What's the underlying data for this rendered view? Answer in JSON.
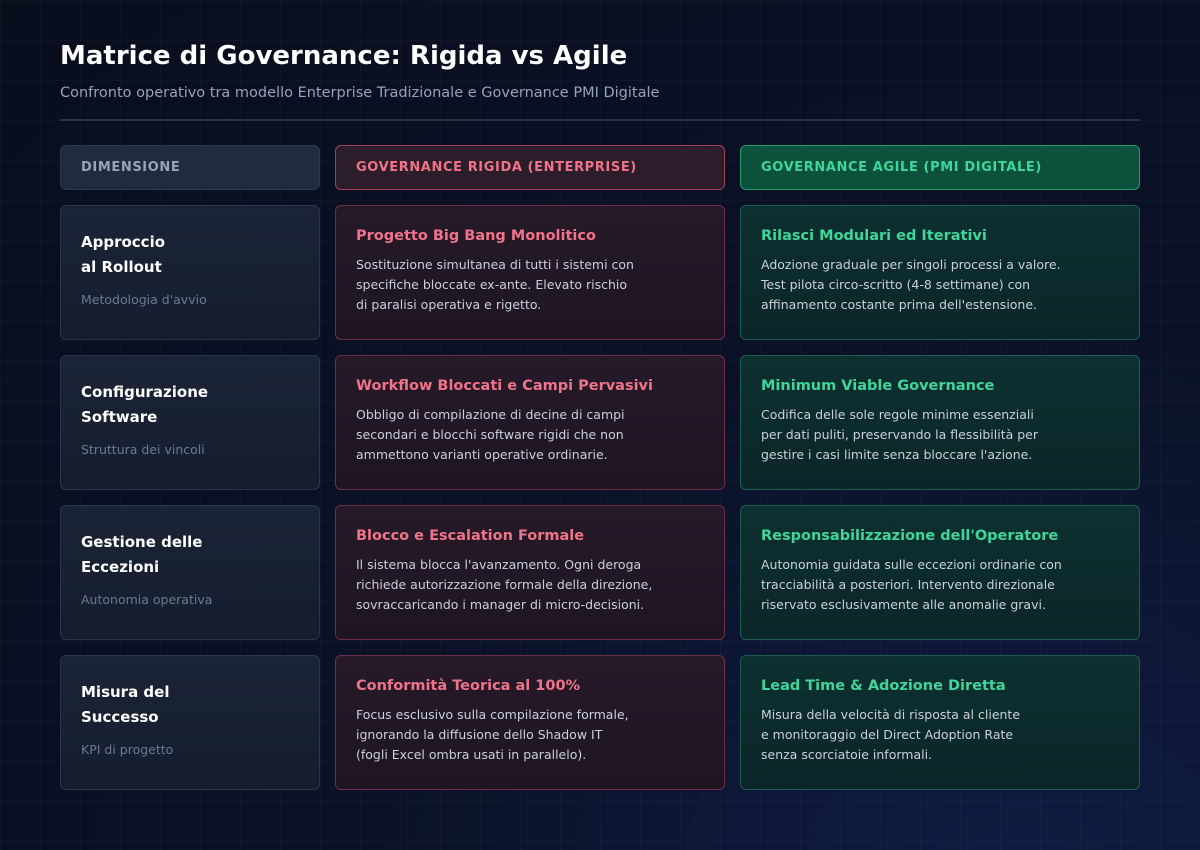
{
  "header": {
    "title": "Matrice di Governance: Rigida vs Agile",
    "subtitle": "Confronto operativo tra modello Enterprise Tradizionale e Governance PMI Digitale"
  },
  "columns": {
    "dimension": "DIMENSIONE",
    "rigid": "GOVERNANCE RIGIDA (ENTERPRISE)",
    "agile": "GOVERNANCE AGILE (PMI DIGITALE)"
  },
  "rows": [
    {
      "dimension": {
        "title": "Approccio\nal Rollout",
        "subtitle": "Metodologia d'avvio"
      },
      "rigid": {
        "title": "Progetto Big Bang Monolitico",
        "description": "Sostituzione simultanea di tutti i sistemi con\nspecifiche bloccate ex-ante. Elevato rischio\ndi paralisi operativa e rigetto."
      },
      "agile": {
        "title": "Rilasci Modulari ed Iterativi",
        "description": "Adozione graduale per singoli processi a valore.\nTest pilota circo-scritto (4-8 settimane) con\naffinamento costante prima dell'estensione."
      }
    },
    {
      "dimension": {
        "title": "Configurazione\nSoftware",
        "subtitle": "Struttura dei vincoli"
      },
      "rigid": {
        "title": "Workflow Bloccati e Campi Pervasivi",
        "description": "Obbligo di compilazione di decine di campi\nsecondari e blocchi software rigidi che non\nammettono varianti operative ordinarie."
      },
      "agile": {
        "title": "Minimum Viable Governance",
        "description": "Codifica delle sole regole minime essenziali\nper dati puliti, preservando la flessibilità per\ngestire i casi limite senza bloccare l'azione."
      }
    },
    {
      "dimension": {
        "title": "Gestione delle\nEccezioni",
        "subtitle": "Autonomia operativa"
      },
      "rigid": {
        "title": "Blocco e Escalation Formale",
        "description": "Il sistema blocca l'avanzamento. Ogni deroga\nrichiede autorizzazione formale della direzione,\nsovraccaricando i manager di micro-decisioni."
      },
      "agile": {
        "title": "Responsabilizzazione dell'Operatore",
        "description": "Autonomia guidata sulle eccezioni ordinarie con\ntracciabilità a posteriori. Intervento direzionale\nriservato esclusivamente alle anomalie gravi."
      }
    },
    {
      "dimension": {
        "title": "Misura del\nSuccesso",
        "subtitle": "KPI di progetto"
      },
      "rigid": {
        "title": "Conformità Teorica al 100%",
        "description": "Focus esclusivo sulla compilazione formale,\nignorando la diffusione dello Shadow IT\n(fogli Excel ombra usati in parallelo)."
      },
      "agile": {
        "title": "Lead Time & Adozione Diretta",
        "description": "Misura della velocità di risposta al cliente\ne monitoraggio del Direct Adoption Rate\nsenza scorciatoie informali."
      }
    }
  ],
  "colors": {
    "rigid_accent": "#f0738a",
    "agile_accent": "#3fd69b",
    "muted_text": "#97a3b6"
  }
}
